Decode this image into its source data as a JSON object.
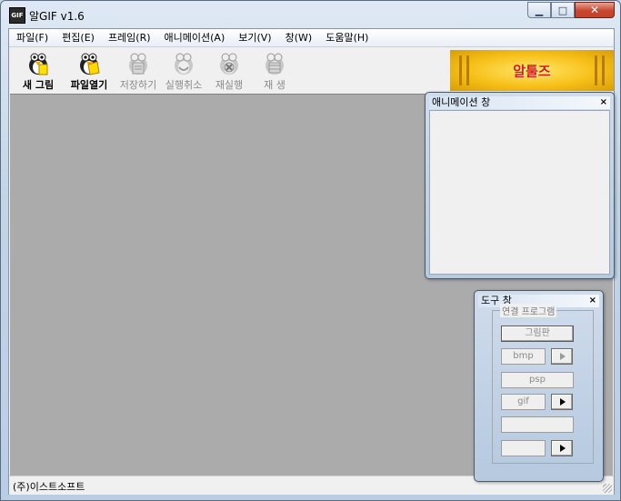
{
  "window": {
    "title": "알GIF v1.6",
    "icon_label": "GIF"
  },
  "caption_buttons": {
    "minimize_icon": "minimize-icon",
    "maximize_icon": "maximize-icon",
    "close_icon": "close-icon"
  },
  "menu": [
    {
      "label": "파일(F)"
    },
    {
      "label": "편집(E)"
    },
    {
      "label": "프레임(R)"
    },
    {
      "label": "애니메이션(A)"
    },
    {
      "label": "보기(V)"
    },
    {
      "label": "창(W)"
    },
    {
      "label": "도움말(H)"
    }
  ],
  "toolbar": [
    {
      "label": "새 그림",
      "icon": "new-image-icon",
      "enabled": true
    },
    {
      "label": "파일열기",
      "icon": "open-file-icon",
      "enabled": true
    },
    {
      "label": "저장하기",
      "icon": "save-icon",
      "enabled": false
    },
    {
      "label": "실행취소",
      "icon": "undo-icon",
      "enabled": false
    },
    {
      "label": "재실행",
      "icon": "redo-icon",
      "enabled": false
    },
    {
      "label": "재 생",
      "icon": "play-icon",
      "enabled": false
    }
  ],
  "banner": {
    "text": "알툴즈"
  },
  "animation_window": {
    "title": "애니메이션 창",
    "close": "×"
  },
  "tool_window": {
    "title": "도구 창",
    "close": "×",
    "group_label": "연결 프로그램",
    "buttons": {
      "paint": "그림판",
      "bmp": "bmp",
      "psp": "psp",
      "gif": "gif",
      "blank1": "",
      "blank2": ""
    }
  },
  "status": {
    "text": "(주)이스트소프트"
  },
  "colors": {
    "workspace": "#ababab",
    "banner": "#f7c018",
    "banner_text": "#d21b1b"
  }
}
